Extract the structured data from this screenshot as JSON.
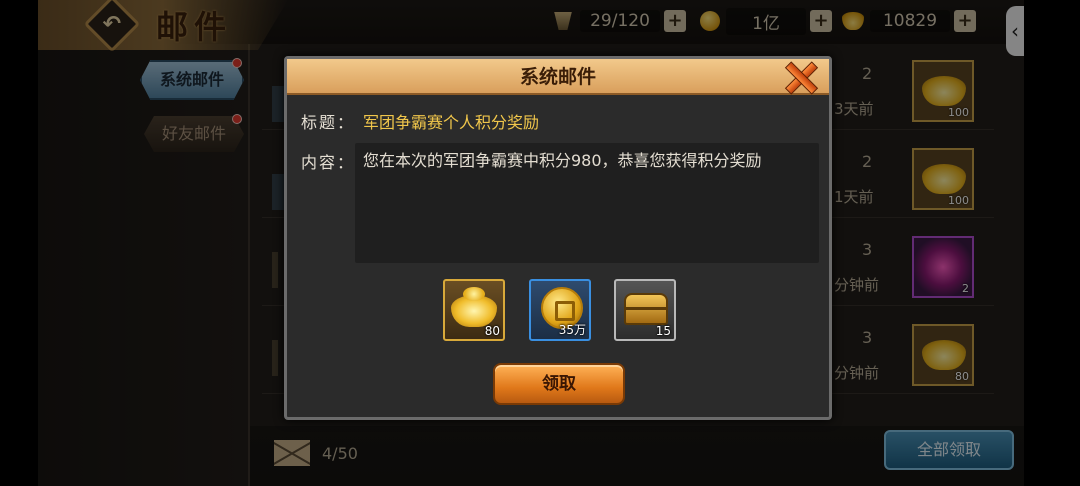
{
  "header": {
    "title": "邮件",
    "back_icon": "back-arrow-icon",
    "resources": {
      "stamina": "29/120",
      "gold": "1亿",
      "ingot": "10829"
    },
    "collapse_glyph": "‹"
  },
  "tabs": [
    {
      "label": "系统邮件",
      "selected": true,
      "has_notification": true
    },
    {
      "label": "好友邮件",
      "selected": false,
      "has_notification": true
    }
  ],
  "mail_list": [
    {
      "count": "2",
      "time": "3天前",
      "item": "gold-ingot-icon",
      "qty": "100"
    },
    {
      "count": "2",
      "time": "1天前",
      "item": "gold-ingot-icon",
      "qty": "100"
    },
    {
      "count": "3",
      "time": "分钟前",
      "item": "purple-orb-icon",
      "qty": "2"
    },
    {
      "count": "3",
      "time": "分钟前",
      "item": "gold-ingot-icon",
      "qty": "80"
    }
  ],
  "footer": {
    "mail_count": "4/50",
    "claim_all_label": "全部领取"
  },
  "dialog": {
    "title": "系统邮件",
    "subject_label": "标题：",
    "subject": "军团争霸赛个人积分奖励",
    "content_label": "内容：",
    "content": "您在本次的军团争霸赛中积分980，恭喜您获得积分奖励",
    "rewards": [
      {
        "icon": "gold-ingot-icon",
        "qty": "80"
      },
      {
        "icon": "gold-coin-icon",
        "qty": "35万"
      },
      {
        "icon": "treasure-chest-icon",
        "qty": "15"
      }
    ],
    "claim_label": "领取"
  }
}
